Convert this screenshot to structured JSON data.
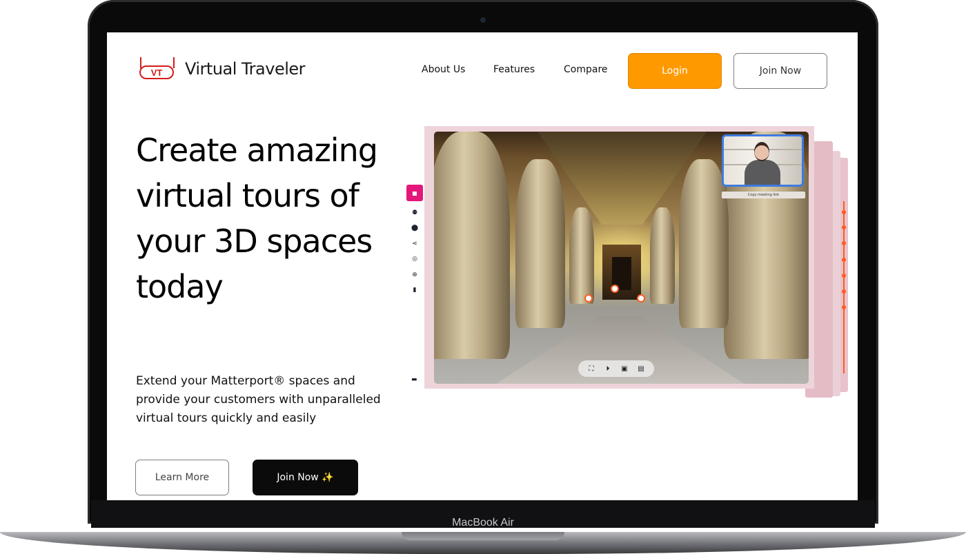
{
  "device": {
    "model_label": "MacBook Air"
  },
  "site": {
    "brand": {
      "logo_mark": "VT",
      "name": "Virtual Traveler"
    },
    "nav": {
      "about": "About Us",
      "features": "Features",
      "compare": "Compare"
    },
    "header_buttons": {
      "login": "Login",
      "join": "Join Now"
    },
    "hero": {
      "title": "Create amazing virtual tours of your 3D spaces today",
      "subtitle": "Extend your Matterport® spaces and provide your customers with unparalleled virtual tours quickly and easily",
      "learn_more": "Learn More",
      "join_now": "Join Now ✨"
    },
    "tour_preview": {
      "video_call": {
        "copy_link_label": "Copy meeting link"
      },
      "sidebar_icons": [
        "contact-icon",
        "users-icon",
        "location-pin-icon",
        "share-icon",
        "target-icon",
        "zoom-icon",
        "map-icon",
        "chat-icon"
      ],
      "toolbar_icons": [
        "fullscreen-icon",
        "play-icon",
        "book-icon",
        "comment-icon"
      ]
    },
    "colors": {
      "accent": "#ff9900",
      "brand_red": "#d51a1a",
      "sidebar_active": "#e4177a",
      "timeline": "#ff5a1f"
    }
  }
}
